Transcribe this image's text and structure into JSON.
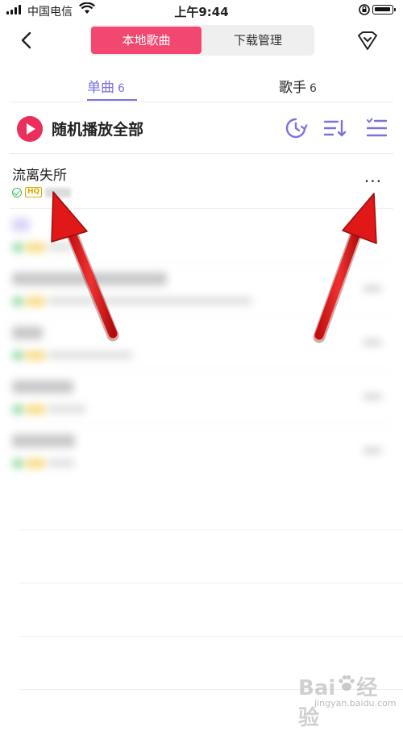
{
  "status_bar": {
    "carrier": "中国电信",
    "time": "上午9:44"
  },
  "header": {
    "tab_local": "本地歌曲",
    "tab_download": "下载管理"
  },
  "subtabs": [
    {
      "label": "单曲",
      "count": "6"
    },
    {
      "label": "歌手",
      "count": "6"
    }
  ],
  "play_all": {
    "label": "随机播放全部"
  },
  "songs": [
    {
      "title": "流离失所",
      "quality": "HQ",
      "more": "···"
    }
  ],
  "watermark": {
    "brand": "Bai",
    "brand2": "经验",
    "url": "jingyan.baidu.com"
  },
  "colors": {
    "accent_pink": "#f24770",
    "accent_purple": "#7a72e0",
    "arrow_red": "#e01818"
  }
}
